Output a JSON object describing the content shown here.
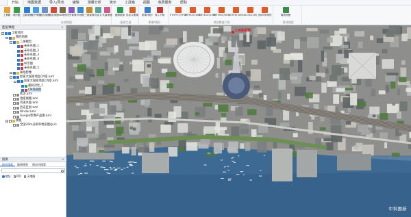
{
  "menu": [
    "开始",
    "地图数据",
    "导入/导出",
    "编辑",
    "测量分析",
    "演示",
    "工具箱",
    "视图",
    "收费服务",
    "帮助"
  ],
  "menu_active": 0,
  "ribbon": {
    "groups": [
      {
        "label": "",
        "buttons": [
          {
            "label": "工具箱",
            "icon": "toolbox-icon",
            "color": "#e8a23a"
          },
          {
            "label": "地形图",
            "icon": "terrain-map-icon",
            "color": "#3a9b4a"
          }
        ]
      },
      {
        "label": "在线地图",
        "buttons": [
          {
            "label": "卫星地图",
            "icon": "satellite-map-icon",
            "color": "#2f7dd6"
          },
          {
            "label": "电子地图",
            "icon": "electronic-map-icon",
            "color": "#4a9de0"
          },
          {
            "label": "混合地图",
            "icon": "hybrid-map-icon",
            "color": "#6b8fc6"
          },
          {
            "label": "地名地图",
            "icon": "place-name-map-icon",
            "color": "#d24a3a"
          },
          {
            "label": "3D地形",
            "icon": "terrain-3d-icon",
            "color": "#7a6a4a"
          },
          {
            "label": "历史影像",
            "icon": "history-image-icon",
            "color": "#8a5cc2"
          },
          {
            "label": "天地图",
            "icon": "tianditu-icon",
            "color": "#3a8ad0"
          },
          {
            "label": "三维影像",
            "icon": "3d-image-icon",
            "color": "#c28a2a"
          },
          {
            "label": "自定义",
            "icon": "custom-map-icon",
            "color": "#5aa5a0"
          },
          {
            "label": "矢量地图",
            "icon": "vector-map-icon",
            "color": "#d25a8a"
          }
        ]
      },
      {
        "label": "图源工具",
        "buttons": [
          {
            "label": "图源更新",
            "icon": "source-update-icon",
            "color": "#2f9a5a"
          },
          {
            "label": "自定义图源",
            "icon": "custom-source-icon",
            "color": "#d0642a"
          }
        ]
      },
      {
        "label": "影像/地形",
        "buttons": [
          {
            "label": "影像/地形",
            "icon": "image-terrain-icon",
            "color": "#3a7fd0"
          },
          {
            "label": "导入下载",
            "icon": "import-download-icon",
            "color": "#c23a3a"
          }
        ]
      },
      {
        "label": "地形数据下载",
        "buttons": [
          {
            "label": "ETOPO1(FFW)",
            "icon": "dem-icon",
            "color": "#e05a2a"
          },
          {
            "label": "SRTM1S(30M)",
            "icon": "dem-icon",
            "color": "#e05a2a"
          },
          {
            "label": "GMTED2(10M)",
            "icon": "dem-icon",
            "color": "#e05a2a"
          },
          {
            "label": "SRTM3S(90M)",
            "icon": "dem-icon",
            "color": "#e05a2a"
          },
          {
            "label": "ASTER(30M)",
            "icon": "dem-icon",
            "color": "#e05a2a"
          },
          {
            "label": "ALOS(12M)",
            "icon": "dem-icon",
            "color": "#e05a2a"
          },
          {
            "label": "全球5米地形",
            "icon": "dem-icon",
            "color": "#e05a2a"
          }
        ]
      },
      {
        "label": "离线地图",
        "buttons": [
          {
            "label": "离线地图",
            "icon": "offline-map-icon",
            "color": "#3a8a4a"
          }
        ]
      }
    ]
  },
  "left_panel": {
    "title": "图层数据",
    "tree": [
      {
        "level": 0,
        "toggle": "-",
        "checked": true,
        "icon_color": "#2a78d8",
        "label": "工程项目"
      },
      {
        "level": 1,
        "toggle": "-",
        "checked": true,
        "icon_color": "#e8b23a",
        "label": "我的地图"
      },
      {
        "level": 2,
        "toggle": "-",
        "checked": true,
        "icon_color": "#e8b23a",
        "label": "二维模型"
      },
      {
        "level": 3,
        "toggle": "",
        "checked": true,
        "icon_color": "#d23a3a",
        "label": "未命名图_1"
      },
      {
        "level": 3,
        "toggle": "",
        "checked": true,
        "icon_color": "#d23a3a",
        "label": "未命名图_2"
      },
      {
        "level": 3,
        "toggle": "",
        "checked": true,
        "icon_color": "#d23a3a",
        "label": "未命名图_3"
      },
      {
        "level": 3,
        "toggle": "",
        "checked": true,
        "icon_color": "#d23a3a",
        "label": "未命名图_4"
      },
      {
        "level": 3,
        "toggle": "",
        "checked": true,
        "icon_color": "#d23a3a",
        "label": "纵示图"
      },
      {
        "level": 3,
        "toggle": "",
        "checked": true,
        "icon_color": "#d23a3a",
        "label": "未命名图_5"
      },
      {
        "level": 2,
        "toggle": "-",
        "checked": true,
        "icon_color": "#e8b23a",
        "label": "离线影像"
      },
      {
        "level": 2,
        "toggle": "-",
        "checked": true,
        "icon_color": "#2a78d8",
        "label": "加拿大国家地区CN塔.kml"
      },
      {
        "level": 3,
        "toggle": "-",
        "checked": true,
        "icon_color": "#2a78d8",
        "label": "加拿大国家地区CN塔.kml"
      },
      {
        "level": 4,
        "toggle": "",
        "checked": true,
        "icon_color": "#3a9b4a",
        "label": "视射对比_1"
      },
      {
        "level": 4,
        "toggle": "",
        "checked": true,
        "icon_color": "#d23a3a",
        "label": "CN塔视频",
        "selected": true
      },
      {
        "level": 2,
        "toggle": "",
        "checked": false,
        "icon_color": "#8a8a8a",
        "label": "客流.kml"
      },
      {
        "level": 2,
        "toggle": "",
        "checked": false,
        "icon_color": "#8a8a8a",
        "label": "电缆线路.kml"
      },
      {
        "level": 2,
        "toggle": "",
        "checked": false,
        "icon_color": "#8a8a8a",
        "label": "河道水面.kml"
      },
      {
        "level": 2,
        "toggle": "",
        "checked": false,
        "icon_color": "#8a8a8a",
        "label": "历史区划.kml"
      },
      {
        "level": 2,
        "toggle": "",
        "checked": false,
        "icon_color": "#8a8a8a",
        "label": "Wnder.kml"
      },
      {
        "level": 2,
        "toggle": "",
        "checked": false,
        "icon_color": "#8a8a8a",
        "label": "Google影像产品图.kml"
      },
      {
        "level": 1,
        "toggle": "+",
        "checked": false,
        "icon_color": "#e8b23a",
        "label": "模板"
      },
      {
        "level": 2,
        "toggle": "",
        "checked": false,
        "icon_color": "#8a8a8a",
        "label": "全国30m分辨率地形图(Jnc)"
      }
    ]
  },
  "search_panel": {
    "title": "搜索",
    "tabs": [
      "地名搜索",
      "路线规划",
      "周边内搜索"
    ],
    "active_tab": 0,
    "placeholder": "",
    "radios": [
      "地址",
      "POI",
      "天地图"
    ],
    "active_radio": 0
  },
  "map": {
    "label": "CN塔视频",
    "watermark": "中科图新"
  }
}
